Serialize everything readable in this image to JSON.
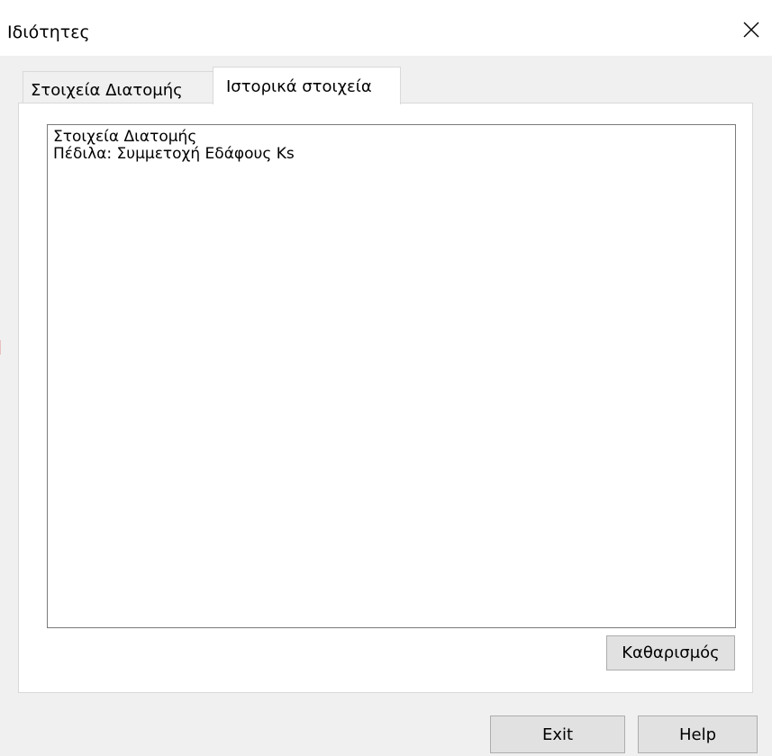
{
  "window": {
    "title": "Ιδιότητες",
    "close_glyph": "✕"
  },
  "tabs": [
    {
      "label": "Στοιχεία Διατομής",
      "active": false
    },
    {
      "label": "Ιστορικά στοιχεία",
      "active": true
    }
  ],
  "history_list": {
    "items": [
      "Στοιχεία Διατομής",
      "Πέδιλα: Συμμετοχή Εδάφους Ks"
    ]
  },
  "buttons": {
    "clear_label": "Καθαρισμός",
    "exit_label": "Exit",
    "help_label": "Help"
  },
  "icons": {
    "close": "close-icon"
  }
}
